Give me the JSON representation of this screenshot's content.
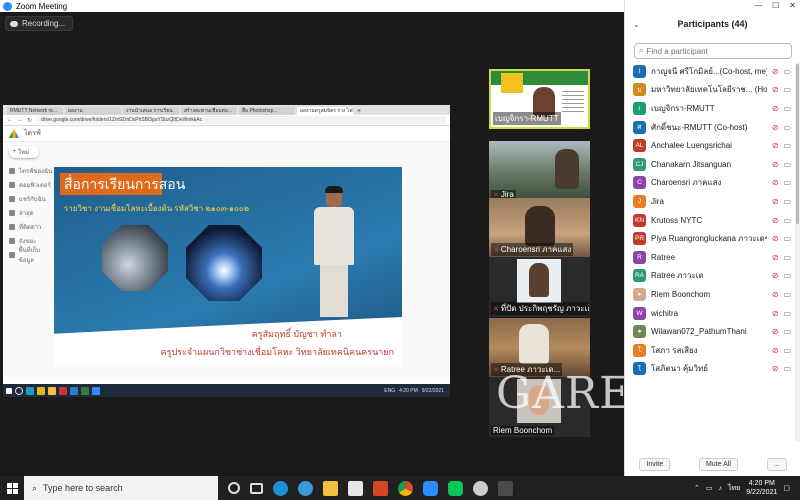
{
  "app": {
    "title": "Zoom Meeting"
  },
  "recording": {
    "label": "Recording..."
  },
  "shared_screen": {
    "tabs": [
      "RMUTT Network re...",
      "ผลงาน",
      "งานนำเสนอ การเรียน",
      "สร้างสะพานเชื่อมต่อ...",
      "สื่อ Photoshop...",
      "ผลงานครูสมจิตร ร่าง ไฟล์"
    ],
    "url": "drive.google.com/drive/folders/1Zm9ZmDxPhSBl3gaYSbzQ8DeWmkkAc",
    "drive_title": "ไดรฟ์",
    "new_label": "ใหม่",
    "sidebar_items": [
      "ไดรฟ์ของฉัน",
      "คอมพิวเตอร์",
      "แชร์กับฉัน",
      "ล่าสุด",
      "ที่ติดดาว",
      "ถังขยะ",
      "พื้นที่เก็บข้อมูล"
    ],
    "slide": {
      "title": "สื่อการเรียนการสอน",
      "subtitle": "รายวิชา งานเชื่อมโลหะเบื้องต้น  รหัสวิชา ๒๑๐๓-๑๐๐๒",
      "teacher_name": "ครูสัมฤทธิ์ บัญชา  ทำลา",
      "teacher_role": "ครูประจำแผนกวิชาช่างเชื่อมโลหะ  วิทยาลัยเทคนิคนครนายก"
    },
    "taskbar_time": "4:20 PM",
    "taskbar_date": "9/22/2021",
    "taskbar_lang": "ENG"
  },
  "video_tiles": [
    {
      "label": "เบญจิกรา-RMUTT",
      "muted": false
    },
    {
      "label": "Jira",
      "muted": true
    },
    {
      "label": "Charoensri ภาคแสง",
      "muted": true
    },
    {
      "label": "ที่ปัด ประกิพฤชรัญ ภาวะเด...",
      "muted": true
    },
    {
      "label": "Ratree ภาวะเด...",
      "muted": true
    },
    {
      "label": "Riem Boonchom",
      "muted": false
    }
  ],
  "watermark": "GARE",
  "participants": {
    "title": "Participants (44)",
    "search_placeholder": "Find a participant",
    "list": [
      {
        "initials": "I",
        "name": "กาญจนี ศรีโกมิลย์...(Co-host, me)",
        "color": "#1a6eb3"
      },
      {
        "initials": "ม",
        "name": "มหาวิทยาลัยเทคโนโลยีราช... (Host)",
        "color": "#d48a1a"
      },
      {
        "initials": "เ",
        "name": "เบญจิกรา-RMUTT",
        "color": "#1aa06e"
      },
      {
        "initials": "ศ",
        "name": "ศักดิ์ชนะ-RMUTT (Co-host)",
        "color": "#1a6eb3"
      },
      {
        "initials": "AL",
        "name": "Anchalee Luengsrichai",
        "color": "#c0392b"
      },
      {
        "initials": "CJ",
        "name": "Chanakarn Jitsanguan",
        "color": "#2e9c6a"
      },
      {
        "initials": "C",
        "name": "Charoensri ภาคแสง",
        "color": "#8e44ad"
      },
      {
        "initials": "J",
        "name": "Jira",
        "color": "#e67e22"
      },
      {
        "initials": "KN",
        "name": "Krutoss NYTC",
        "color": "#c0392b"
      },
      {
        "initials": "PR",
        "name": "Piya Ruangrongluckana ภาวะเดชพร",
        "color": "#c0392b"
      },
      {
        "initials": "R",
        "name": "Ratree",
        "color": "#8e44ad"
      },
      {
        "initials": "RA",
        "name": "Ratree ภาวะเด",
        "color": "#2e9c6a"
      },
      {
        "initials": "●",
        "name": "Riem Boonchom",
        "color": "#d2a98a"
      },
      {
        "initials": "W",
        "name": "wichitra",
        "color": "#8e44ad"
      },
      {
        "initials": "●",
        "name": "Wilawan072_PathumThani",
        "color": "#6b8a5a"
      },
      {
        "initials": "โ",
        "name": "โสภา รสเสียง",
        "color": "#e67e22"
      },
      {
        "initials": "โ",
        "name": "โสภิตนา คุ้มวิทย์",
        "color": "#1a6eb3"
      }
    ],
    "invite_label": "Invite",
    "mute_all_label": "Mute All",
    "more_label": "..."
  },
  "taskbar": {
    "search_placeholder": "Type here to search",
    "time": "4:20 PM",
    "date": "9/22/2021",
    "lang": "ไทย"
  }
}
